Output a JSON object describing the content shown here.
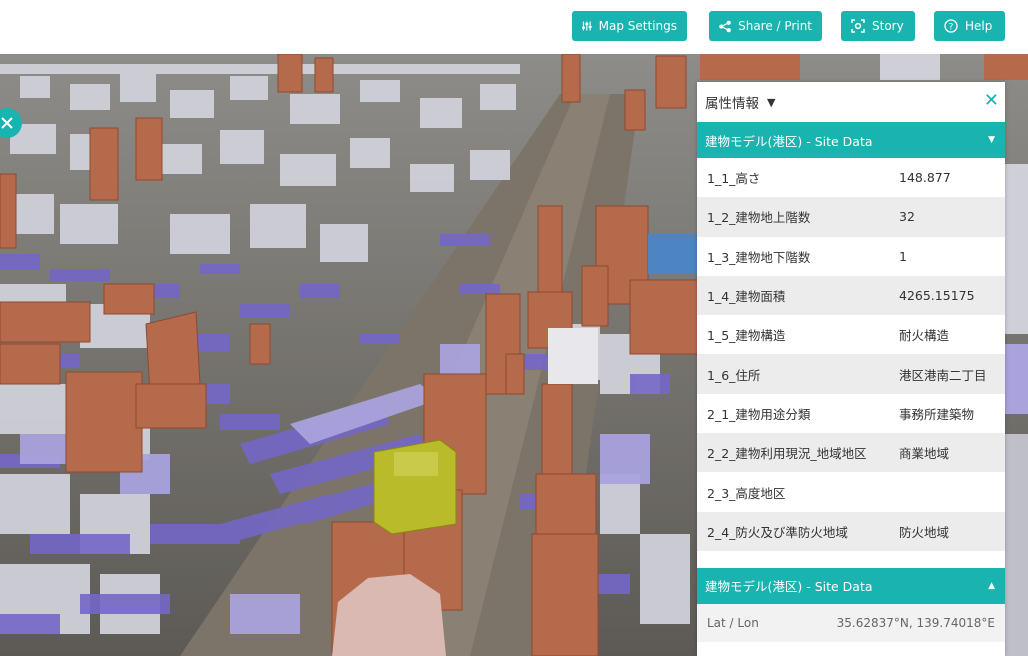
{
  "toolbar": {
    "map_settings": "Map Settings",
    "share_print": "Share / Print",
    "story": "Story",
    "help": "Help",
    "accent": "#19b3b0"
  },
  "panel": {
    "title": "属性情報",
    "section_title": "建物モデル(港区) - Site Data",
    "footer_section_title": "建物モデル(港区) - Site Data",
    "rows": [
      {
        "key": "1_1_高さ",
        "value": "148.877"
      },
      {
        "key": "1_2_建物地上階数",
        "value": "32"
      },
      {
        "key": "1_3_建物地下階数",
        "value": "1"
      },
      {
        "key": "1_4_建物面積",
        "value": "4265.15175"
      },
      {
        "key": "1_5_建物構造",
        "value": "耐火構造"
      },
      {
        "key": "1_6_住所",
        "value": "港区港南二丁目"
      },
      {
        "key": "2_1_建物用途分類",
        "value": "事務所建築物"
      },
      {
        "key": "2_2_建物利用現況_地域地区",
        "value": "商業地域"
      },
      {
        "key": "2_3_高度地区",
        "value": ""
      },
      {
        "key": "2_4_防火及び準防火地域",
        "value": "防火地域"
      }
    ],
    "latlon_label": "Lat / Lon",
    "latlon_value": "35.62837°N, 139.74018°E"
  }
}
